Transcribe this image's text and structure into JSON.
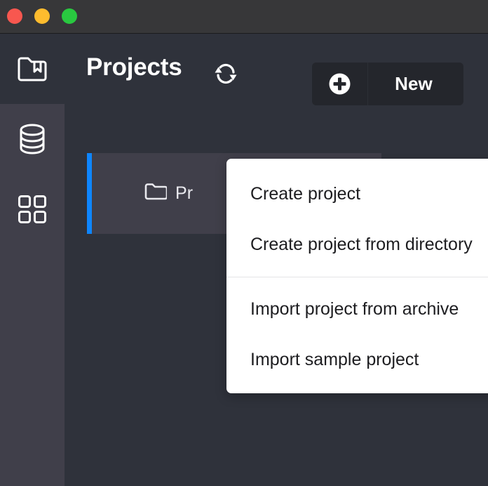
{
  "window": {
    "traffic_lights": [
      {
        "name": "close",
        "color": "#f8574f"
      },
      {
        "name": "minimize",
        "color": "#febc2e"
      },
      {
        "name": "maximize",
        "color": "#29c840"
      }
    ]
  },
  "sidebar": {
    "items": [
      {
        "icon": "folder-bookmark-icon",
        "name": "projects",
        "active": true
      },
      {
        "icon": "database-icon",
        "name": "datasources",
        "active": false
      },
      {
        "icon": "grid-icon",
        "name": "apps",
        "active": false
      }
    ]
  },
  "header": {
    "title": "Projects",
    "refresh_icon": "refresh-icon",
    "new_button": {
      "label": "New",
      "icon": "plus-circle-icon"
    }
  },
  "project_list": {
    "items": [
      {
        "icon": "folder-icon",
        "name": "Pr",
        "selected": true,
        "accent_color": "#0e86ff"
      }
    ]
  },
  "menu": {
    "groups": [
      {
        "items": [
          {
            "label": "Create project",
            "name": "create-project"
          },
          {
            "label": "Create project from directory",
            "name": "create-project-from-directory"
          }
        ]
      },
      {
        "items": [
          {
            "label": "Import project from archive",
            "name": "import-project-from-archive"
          },
          {
            "label": "Import sample project",
            "name": "import-sample-project"
          }
        ]
      }
    ]
  },
  "colors": {
    "titlebar": "#373739",
    "sidebar": "#403f4a",
    "main_bg": "#2f323b",
    "card_bg": "#403f4a",
    "accent_blue": "#0e86ff",
    "button_bg": "#24262c",
    "menu_bg": "#ffffff",
    "menu_text": "#1d1d20",
    "separator": "#e4e4e6"
  }
}
